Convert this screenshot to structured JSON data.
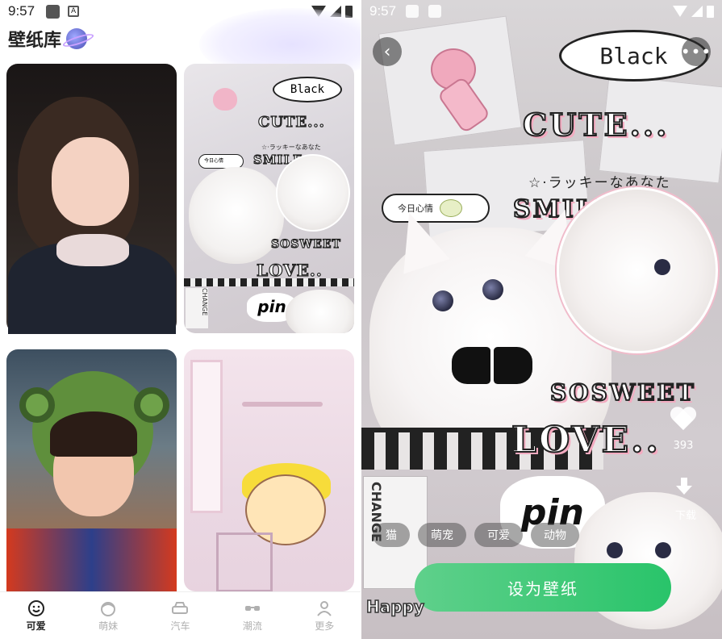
{
  "left": {
    "status": {
      "time": "9:57",
      "a_icon": "A"
    },
    "header": {
      "title": "壁纸库"
    },
    "collage_card": {
      "black": "Black",
      "cute": "CUTE...",
      "smile": "SMILE...",
      "sosweet": "SOSWEET",
      "love": "LOVE..",
      "mood": "今日心情",
      "jp": "☆·ラッキーなあなた",
      "pin": "pin",
      "change": "CHANGE"
    },
    "bottom_nav": [
      {
        "label": "可爱",
        "icon": "smile-face-icon",
        "active": true
      },
      {
        "label": "萌妹",
        "icon": "girl-face-icon",
        "active": false
      },
      {
        "label": "汽车",
        "icon": "car-icon",
        "active": false
      },
      {
        "label": "潮流",
        "icon": "glasses-icon",
        "active": false
      },
      {
        "label": "更多",
        "icon": "person-icon",
        "active": false
      }
    ]
  },
  "right": {
    "status": {
      "time": "9:57"
    },
    "bubble_text": "Black",
    "cute_text": "CUTE...",
    "jp_text": "☆·ラッキーなあなた",
    "smile_text": "SMILE...",
    "mood_text": "今日心情",
    "sosweet_text": "SOSWEET",
    "love_text": "LOVE..",
    "pin_text": "pin",
    "change_text": "CHANGE",
    "happy_text": "Happy",
    "like_count": "393",
    "download_label": "下载",
    "tags": [
      "猫",
      "萌宠",
      "可爱",
      "动物"
    ],
    "set_wallpaper_label": "设为壁纸",
    "accent": "#29c46a"
  }
}
